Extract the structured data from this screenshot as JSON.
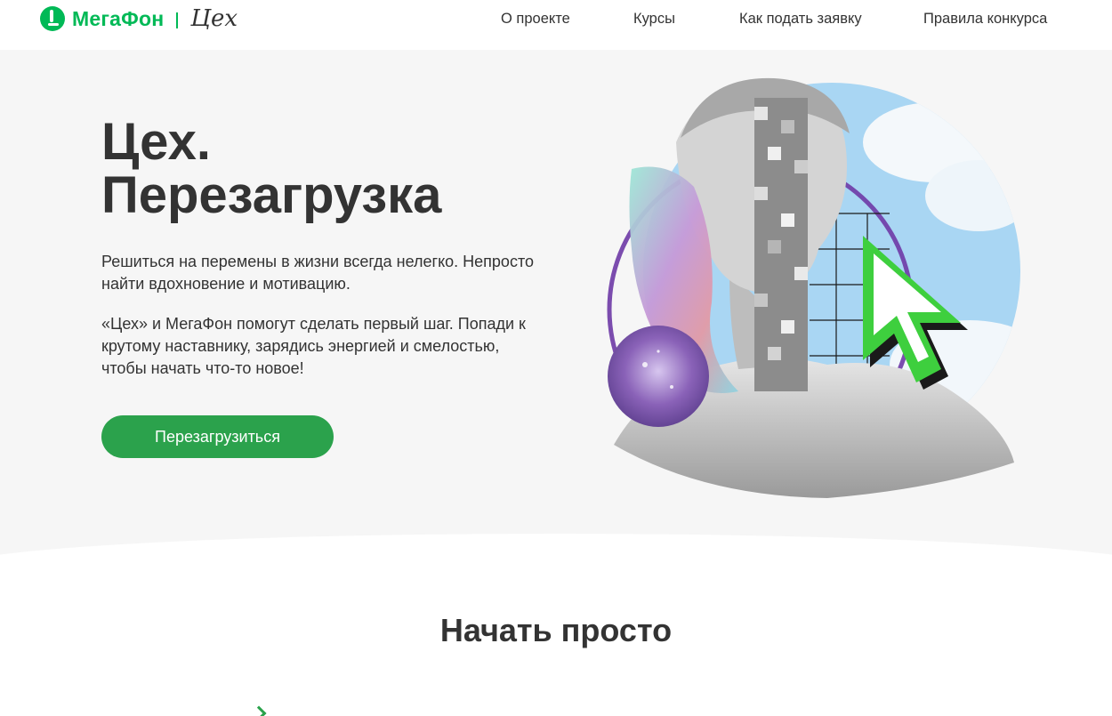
{
  "header": {
    "brand": "МегаФон",
    "partner": "Цех",
    "nav": [
      {
        "label": "О проекте"
      },
      {
        "label": "Курсы"
      },
      {
        "label": "Как подать заявку"
      },
      {
        "label": "Правила конкурса"
      }
    ]
  },
  "hero": {
    "title_line1": "Цех.",
    "title_line2": "Перезагрузка",
    "paragraph1": "Решиться на перемены в жизни всегда нелегко. Непросто найти вдохновение и мотивацию.",
    "paragraph2": "«Цех» и МегаФон помогут сделать первый шаг. Попади к крутому наставнику, зарядись энергией и смелостью, чтобы начать что-то новое!",
    "cta_label": "Перезагрузиться"
  },
  "section": {
    "title": "Начать просто"
  },
  "colors": {
    "brand_green": "#00b956",
    "button_green": "#2ba24c",
    "text": "#333333",
    "hero_bg": "#f6f6f6"
  }
}
